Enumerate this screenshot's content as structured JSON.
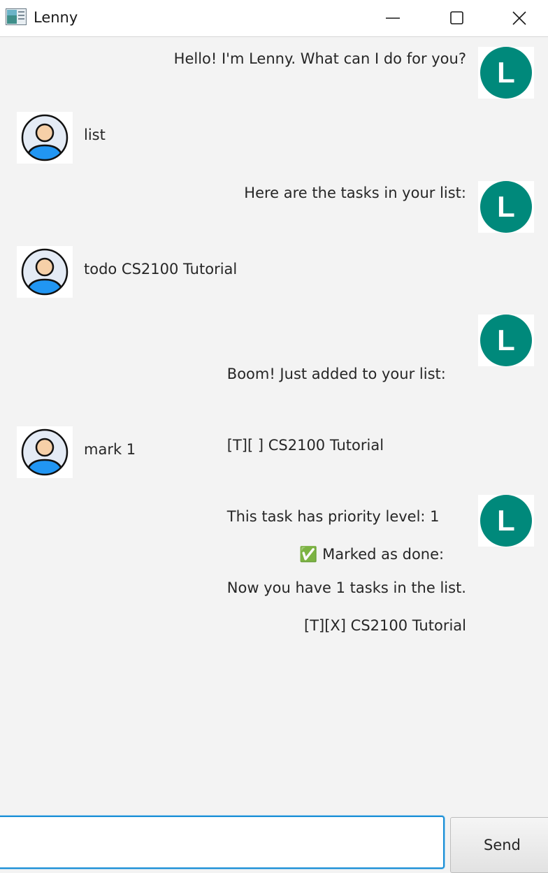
{
  "window": {
    "title": "Lenny"
  },
  "dialog": {
    "messages": [
      {
        "sender": "lenny",
        "lines": [
          "Hello! I'm Lenny. What can I do for you?"
        ]
      },
      {
        "sender": "user",
        "lines": [
          "list"
        ]
      },
      {
        "sender": "lenny",
        "lines": [
          "Here are the tasks in your list:"
        ]
      },
      {
        "sender": "user",
        "lines": [
          "todo CS2100 Tutorial"
        ]
      },
      {
        "sender": "lenny",
        "lines": [
          "Boom! Just added to your list:",
          "[T][ ] CS2100 Tutorial",
          "This task has priority level: 1",
          "Now you have 1 tasks in the list."
        ]
      },
      {
        "sender": "user",
        "lines": [
          "mark 1"
        ]
      },
      {
        "sender": "lenny",
        "lines": [
          "✅ Marked as done:",
          " [T][X] CS2100 Tutorial"
        ]
      }
    ],
    "lenny_avatar_letter": "L"
  },
  "input": {
    "value": "",
    "placeholder": ""
  },
  "send_button": {
    "label": "Send"
  },
  "colors": {
    "lenny_green": "#00897b",
    "user_shirt": "#2196f3",
    "focus_blue": "#1b8fd6"
  }
}
